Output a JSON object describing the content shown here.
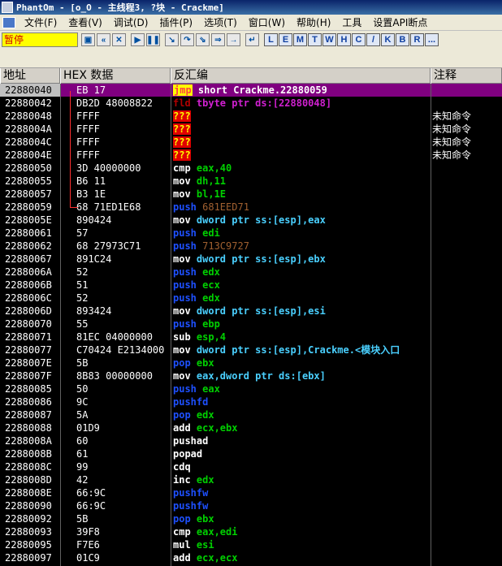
{
  "window": {
    "title": "PhantOm - [o_O -  主线程3, ?块 - Crackme]"
  },
  "menu": {
    "items": [
      "文件(F)",
      "查看(V)",
      "调试(D)",
      "插件(P)",
      "选项(T)",
      "窗口(W)",
      "帮助(H)",
      "工具",
      "设置API断点"
    ]
  },
  "toolbar": {
    "status": "暂停",
    "buttons": [
      "open-icon",
      "rewind-icon",
      "close-icon",
      "run-icon",
      "pause-icon",
      "step-into-icon",
      "step-over-icon",
      "trace-into-icon",
      "trace-over-icon",
      "execute-till-return-icon",
      "goto-icon"
    ],
    "letters": [
      "L",
      "E",
      "M",
      "T",
      "W",
      "H",
      "C",
      "/",
      "K",
      "B",
      "R",
      "..."
    ]
  },
  "columns": {
    "address": "地址",
    "hex": "HEX 数据",
    "disasm": "反汇编",
    "comment": "注释"
  },
  "rows": [
    {
      "addr": "22880040",
      "hex": "EB 17",
      "mn": "jmp",
      "ops": " short Crackme.22880059",
      "cmt": "",
      "selected": true,
      "style": "jmp"
    },
    {
      "addr": "22880042",
      "hex": "DB2D 48008822",
      "mn": "fld",
      "ops": " tbyte ptr ds:[22880048]",
      "cmt": "",
      "style": "fld"
    },
    {
      "addr": "22880048",
      "hex": "FFFF",
      "mn": "???",
      "ops": "",
      "cmt": "未知命令",
      "style": "bad"
    },
    {
      "addr": "2288004A",
      "hex": "FFFF",
      "mn": "???",
      "ops": "",
      "cmt": "未知命令",
      "style": "bad"
    },
    {
      "addr": "2288004C",
      "hex": "FFFF",
      "mn": "???",
      "ops": "",
      "cmt": "未知命令",
      "style": "bad"
    },
    {
      "addr": "2288004E",
      "hex": "FFFF",
      "mn": "???",
      "ops": "",
      "cmt": "未知命令",
      "style": "bad"
    },
    {
      "addr": "22880050",
      "hex": "3D 40000000",
      "mn": "cmp",
      "ops": " eax,40",
      "cmt": "",
      "style": "white-reg-imm"
    },
    {
      "addr": "22880055",
      "hex": "B6 11",
      "mn": "mov",
      "ops": " dh,11",
      "cmt": "",
      "style": "white-reg-imm"
    },
    {
      "addr": "22880057",
      "hex": "B3 1E",
      "mn": "mov",
      "ops": " bl,1E",
      "cmt": "",
      "style": "white-reg-imm"
    },
    {
      "addr": "22880059",
      "hex": "68 71ED1E68",
      "mn": "push",
      "ops": " 681EED71",
      "cmt": "",
      "style": "blue-imm"
    },
    {
      "addr": "2288005E",
      "hex": "890424",
      "mn": "mov",
      "ops": " dword ptr ss:[esp],eax",
      "cmt": "",
      "style": "white-mem"
    },
    {
      "addr": "22880061",
      "hex": "57",
      "mn": "push",
      "ops": " edi",
      "cmt": "",
      "style": "blue-reg"
    },
    {
      "addr": "22880062",
      "hex": "68 27973C71",
      "mn": "push",
      "ops": " 713C9727",
      "cmt": "",
      "style": "blue-imm"
    },
    {
      "addr": "22880067",
      "hex": "891C24",
      "mn": "mov",
      "ops": " dword ptr ss:[esp],ebx",
      "cmt": "",
      "style": "white-mem"
    },
    {
      "addr": "2288006A",
      "hex": "52",
      "mn": "push",
      "ops": " edx",
      "cmt": "",
      "style": "blue-reg"
    },
    {
      "addr": "2288006B",
      "hex": "51",
      "mn": "push",
      "ops": " ecx",
      "cmt": "",
      "style": "blue-reg"
    },
    {
      "addr": "2288006C",
      "hex": "52",
      "mn": "push",
      "ops": " edx",
      "cmt": "",
      "style": "blue-reg"
    },
    {
      "addr": "2288006D",
      "hex": "893424",
      "mn": "mov",
      "ops": " dword ptr ss:[esp],esi",
      "cmt": "",
      "style": "white-mem"
    },
    {
      "addr": "22880070",
      "hex": "55",
      "mn": "push",
      "ops": " ebp",
      "cmt": "",
      "style": "blue-reg"
    },
    {
      "addr": "22880071",
      "hex": "81EC 04000000",
      "mn": "sub",
      "ops": " esp,4",
      "cmt": "",
      "style": "white-reg-imm"
    },
    {
      "addr": "22880077",
      "hex": "C70424 E2134000",
      "mn": "mov",
      "ops": " dword ptr ss:[esp],Crackme.<模块入口",
      "cmt": "",
      "style": "white-mem"
    },
    {
      "addr": "2288007E",
      "hex": "5B",
      "mn": "pop",
      "ops": " ebx",
      "cmt": "",
      "style": "blue-reg"
    },
    {
      "addr": "2288007F",
      "hex": "8B83 00000000",
      "mn": "mov",
      "ops": " eax,dword ptr ds:[ebx]",
      "cmt": "",
      "style": "white-mem"
    },
    {
      "addr": "22880085",
      "hex": "50",
      "mn": "push",
      "ops": " eax",
      "cmt": "",
      "style": "blue-reg"
    },
    {
      "addr": "22880086",
      "hex": "9C",
      "mn": "pushfd",
      "ops": "",
      "cmt": "",
      "style": "blue-reg"
    },
    {
      "addr": "22880087",
      "hex": "5A",
      "mn": "pop",
      "ops": " edx",
      "cmt": "",
      "style": "blue-reg"
    },
    {
      "addr": "22880088",
      "hex": "01D9",
      "mn": "add",
      "ops": " ecx,ebx",
      "cmt": "",
      "style": "white-reg"
    },
    {
      "addr": "2288008A",
      "hex": "60",
      "mn": "pushad",
      "ops": "",
      "cmt": "",
      "style": "white-reg"
    },
    {
      "addr": "2288008B",
      "hex": "61",
      "mn": "popad",
      "ops": "",
      "cmt": "",
      "style": "white-reg"
    },
    {
      "addr": "2288008C",
      "hex": "99",
      "mn": "cdq",
      "ops": "",
      "cmt": "",
      "style": "white-reg"
    },
    {
      "addr": "2288008D",
      "hex": "42",
      "mn": "inc",
      "ops": " edx",
      "cmt": "",
      "style": "white-reg"
    },
    {
      "addr": "2288008E",
      "hex": "66:9C",
      "mn": "pushfw",
      "ops": "",
      "cmt": "",
      "style": "blue-reg"
    },
    {
      "addr": "22880090",
      "hex": "66:9C",
      "mn": "pushfw",
      "ops": "",
      "cmt": "",
      "style": "blue-reg"
    },
    {
      "addr": "22880092",
      "hex": "5B",
      "mn": "pop",
      "ops": " ebx",
      "cmt": "",
      "style": "blue-reg"
    },
    {
      "addr": "22880093",
      "hex": "39F8",
      "mn": "cmp",
      "ops": " eax,edi",
      "cmt": "",
      "style": "white-reg"
    },
    {
      "addr": "22880095",
      "hex": "F7E6",
      "mn": "mul",
      "ops": " esi",
      "cmt": "",
      "style": "white-reg"
    },
    {
      "addr": "22880097",
      "hex": "01C9",
      "mn": "add",
      "ops": " ecx,ecx",
      "cmt": "",
      "style": "white-reg"
    }
  ]
}
